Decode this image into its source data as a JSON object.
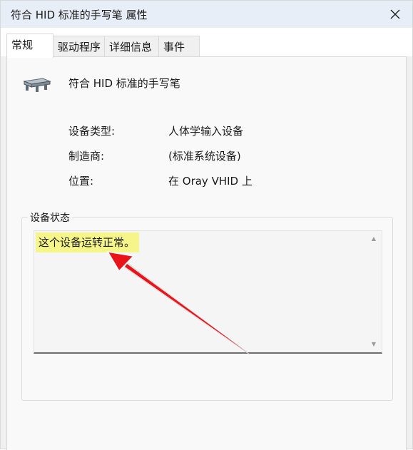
{
  "window": {
    "title": "符合 HID 标准的手写笔 属性",
    "close_icon": "close-icon"
  },
  "tabs": [
    {
      "label": "常规",
      "active": true
    },
    {
      "label": "驱动程序",
      "active": false
    },
    {
      "label": "详细信息",
      "active": false
    },
    {
      "label": "事件",
      "active": false
    }
  ],
  "device": {
    "icon": "pen-device-icon",
    "name": "符合 HID 标准的手写笔"
  },
  "properties": [
    {
      "label": "设备类型:",
      "value": "人体学输入设备"
    },
    {
      "label": "制造商:",
      "value": "(标准系统设备)"
    },
    {
      "label": "位置:",
      "value": "在 Oray VHID 上"
    }
  ],
  "status_group": {
    "legend": "设备状态",
    "text": "这个设备运转正常。",
    "highlight_color": "#f5f58a"
  },
  "annotation": {
    "type": "red-arrow",
    "color": "#e8141a"
  }
}
